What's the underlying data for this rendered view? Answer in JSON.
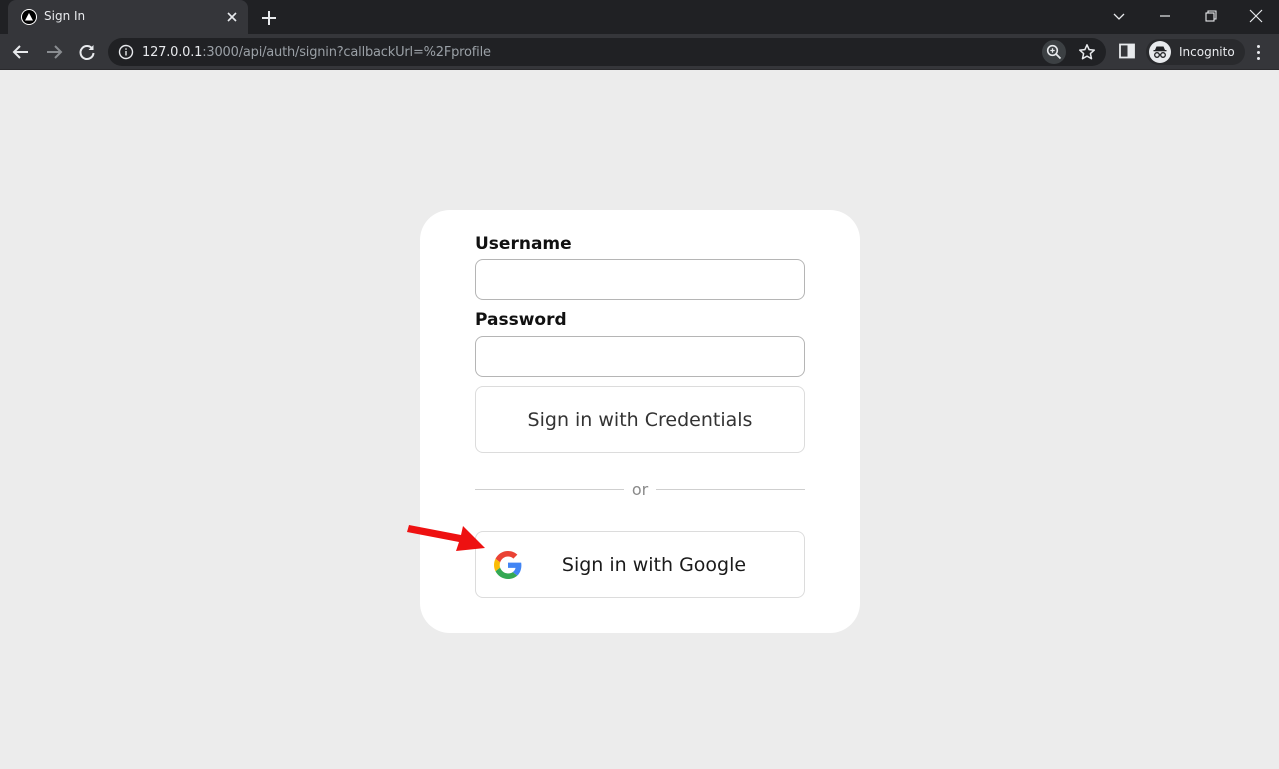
{
  "browser": {
    "tab_title": "Sign In",
    "url_host": "127.0.0.1",
    "url_path": ":3000/api/auth/signin?callbackUrl=%2Fprofile",
    "profile_label": "Incognito"
  },
  "form": {
    "username_label": "Username",
    "password_label": "Password",
    "credentials_button": "Sign in with Credentials",
    "divider_text": "or",
    "google_button": "Sign in with Google"
  },
  "colors": {
    "page_background": "#ececec",
    "card_background": "#ffffff",
    "annotation_arrow": "#ee1111"
  },
  "icons": [
    "tab-favicon-icon",
    "close-icon",
    "plus-icon",
    "chevron-down-icon",
    "minimize-icon",
    "restore-icon",
    "window-close-icon",
    "back-icon",
    "forward-icon",
    "reload-icon",
    "info-icon",
    "zoom-icon",
    "star-icon",
    "side-panel-icon",
    "incognito-icon",
    "more-menu-icon",
    "google-logo-icon",
    "red-arrow-annotation"
  ]
}
